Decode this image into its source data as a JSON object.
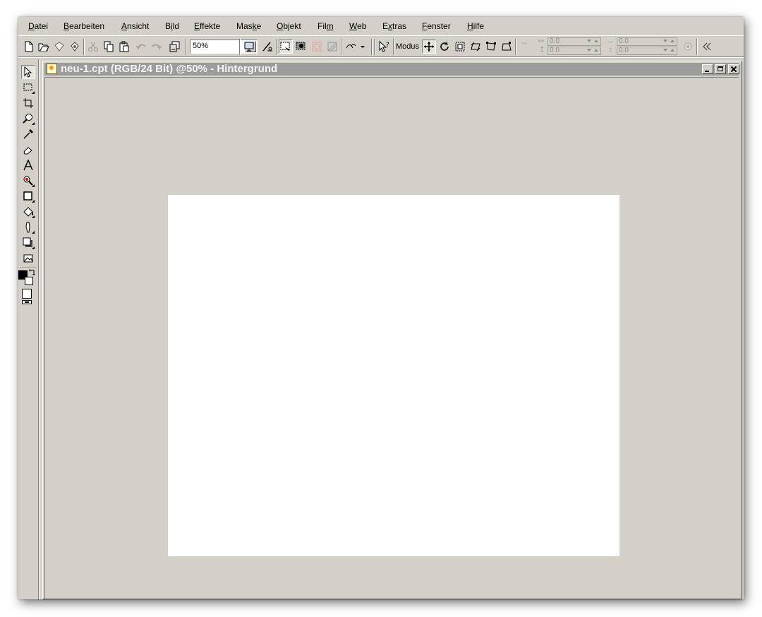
{
  "menubar": {
    "items": [
      {
        "pre": "",
        "acc": "D",
        "post": "atei"
      },
      {
        "pre": "",
        "acc": "B",
        "post": "earbeiten"
      },
      {
        "pre": "",
        "acc": "A",
        "post": "nsicht"
      },
      {
        "pre": "B",
        "acc": "i",
        "post": "ld"
      },
      {
        "pre": "",
        "acc": "E",
        "post": "ffekte"
      },
      {
        "pre": "Mas",
        "acc": "k",
        "post": "e"
      },
      {
        "pre": "",
        "acc": "O",
        "post": "bjekt"
      },
      {
        "pre": "Fil",
        "acc": "m",
        "post": ""
      },
      {
        "pre": "",
        "acc": "W",
        "post": "eb"
      },
      {
        "pre": "E",
        "acc": "x",
        "post": "tras"
      },
      {
        "pre": "",
        "acc": "F",
        "post": "enster"
      },
      {
        "pre": "",
        "acc": "H",
        "post": "ilfe"
      }
    ]
  },
  "toolbar": {
    "zoom_value": "50%",
    "modus_label": "Modus",
    "x_value": "0.0",
    "y_value": "0.0",
    "w_value": "0.0",
    "h_value": "0.0"
  },
  "document": {
    "title": "neu-1.cpt (RGB/24 Bit) @50% - Hintergrund"
  },
  "colors": {
    "chrome": "#d4d0c8",
    "titlebar_inactive": "#9c9c9c",
    "canvas": "#ffffff"
  }
}
